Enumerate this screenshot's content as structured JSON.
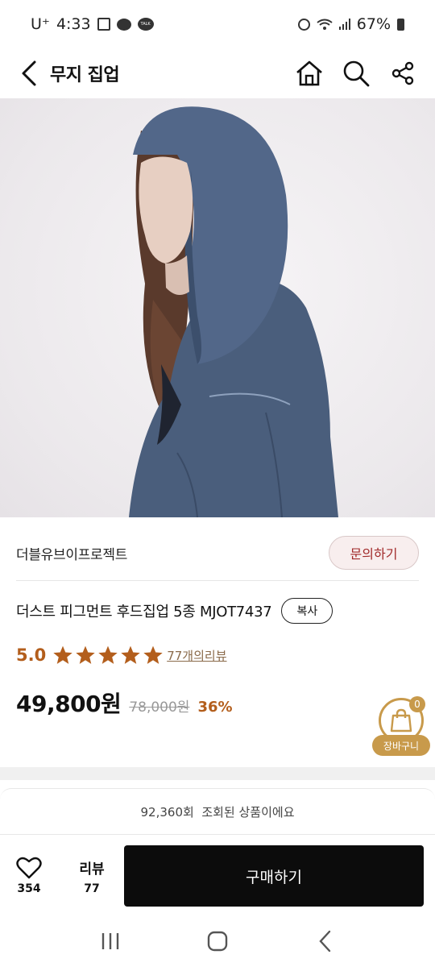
{
  "status": {
    "carrier": "U⁺",
    "time": "4:33",
    "battery": "67%",
    "talk_badge": "TALK"
  },
  "header": {
    "title": "무지 집업",
    "icons": [
      "chevron-left-icon",
      "home-icon",
      "search-icon",
      "share-icon"
    ]
  },
  "product": {
    "brand": "더블유브이프로젝트",
    "inquiry_label": "문의하기",
    "title": "더스트 피그먼트 후드집업 5종 MJOT7437",
    "copy_label": "복사",
    "rating": "5.0",
    "stars": 5,
    "review_link": "77개의리뷰",
    "price": "49,800원",
    "original_price": "78,000원",
    "discount": "36%"
  },
  "cart": {
    "count": "0",
    "label": "장바구니"
  },
  "views_text": "92,360회  조회된 상품이에요",
  "action_bar": {
    "likes": "354",
    "review_label": "리뷰",
    "review_count": "77",
    "buy_label": "구매하기"
  },
  "colors": {
    "accent_orange": "#b35e1c",
    "cart_gold": "#c89a4b",
    "inquiry_text": "#a12a2a",
    "buy_bg": "#0c0c0c"
  }
}
